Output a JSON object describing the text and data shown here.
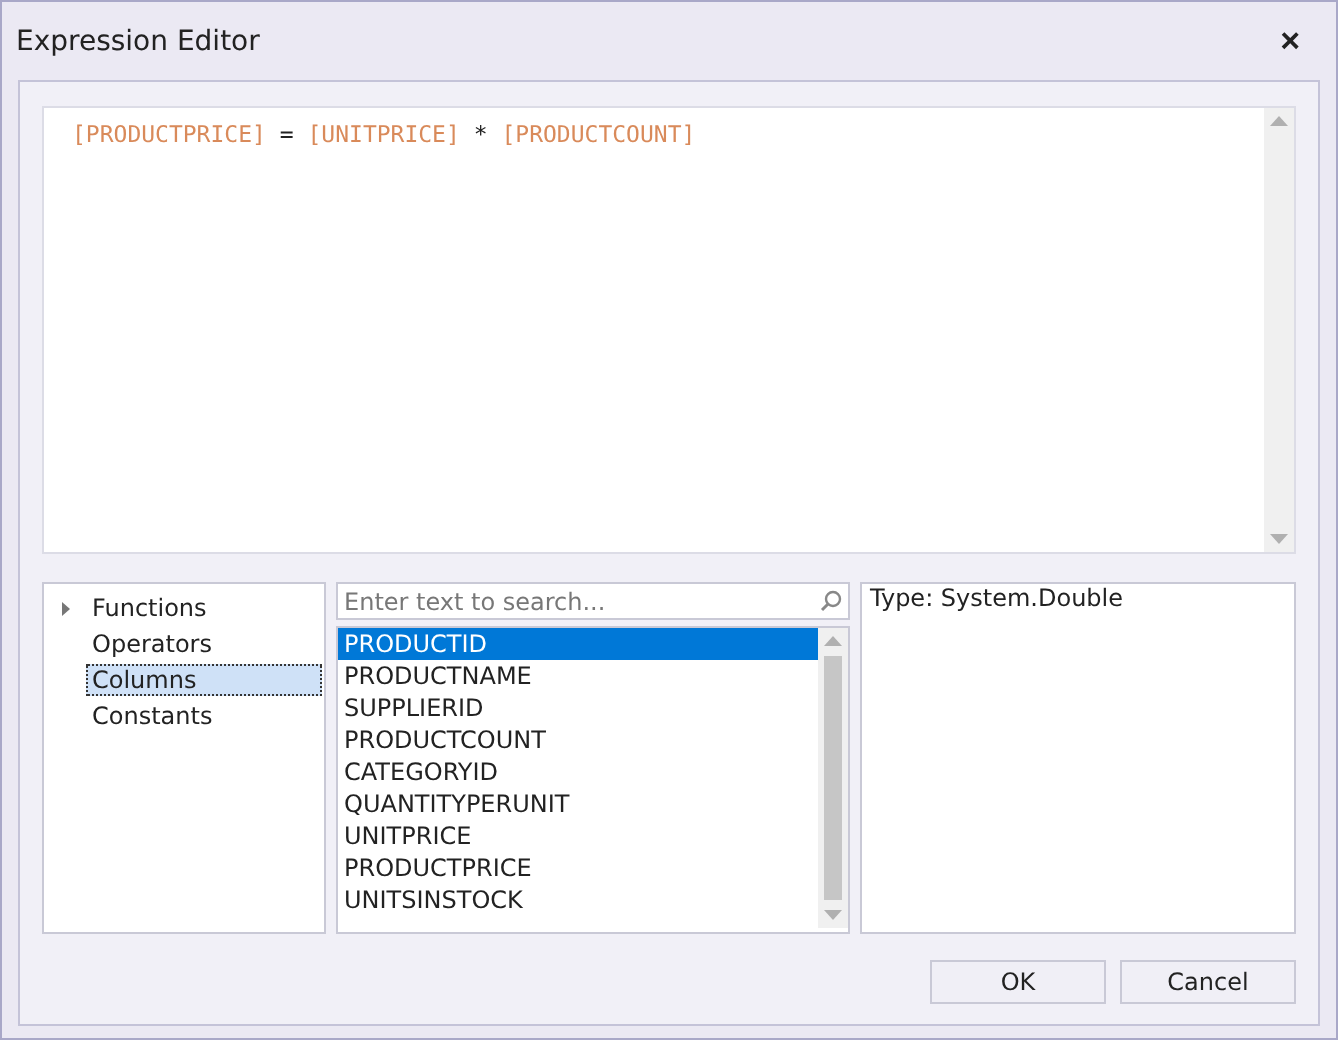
{
  "window": {
    "title": "Expression Editor",
    "close": "×"
  },
  "expression": [
    {
      "kind": "column",
      "text": "[PRODUCTPRICE]"
    },
    {
      "kind": "operator",
      "text": "="
    },
    {
      "kind": "column",
      "text": "[UNITPRICE]"
    },
    {
      "kind": "operator",
      "text": "*"
    },
    {
      "kind": "column",
      "text": "[PRODUCTCOUNT]"
    }
  ],
  "categories": [
    {
      "label": "Functions",
      "expandable": true,
      "selected": false
    },
    {
      "label": "Operators",
      "expandable": false,
      "selected": false
    },
    {
      "label": "Columns",
      "expandable": false,
      "selected": true
    },
    {
      "label": "Constants",
      "expandable": false,
      "selected": false
    }
  ],
  "search": {
    "placeholder": "Enter text to search..."
  },
  "items": [
    {
      "label": "PRODUCTID",
      "selected": true
    },
    {
      "label": "PRODUCTNAME",
      "selected": false
    },
    {
      "label": "SUPPLIERID",
      "selected": false
    },
    {
      "label": "PRODUCTCOUNT",
      "selected": false
    },
    {
      "label": "CATEGORYID",
      "selected": false
    },
    {
      "label": "QUANTITYPERUNIT",
      "selected": false
    },
    {
      "label": "UNITPRICE",
      "selected": false
    },
    {
      "label": "PRODUCTPRICE",
      "selected": false
    },
    {
      "label": "UNITSINSTOCK",
      "selected": false
    }
  ],
  "description": "Type: System.Double",
  "buttons": [
    "OK",
    "Cancel"
  ]
}
